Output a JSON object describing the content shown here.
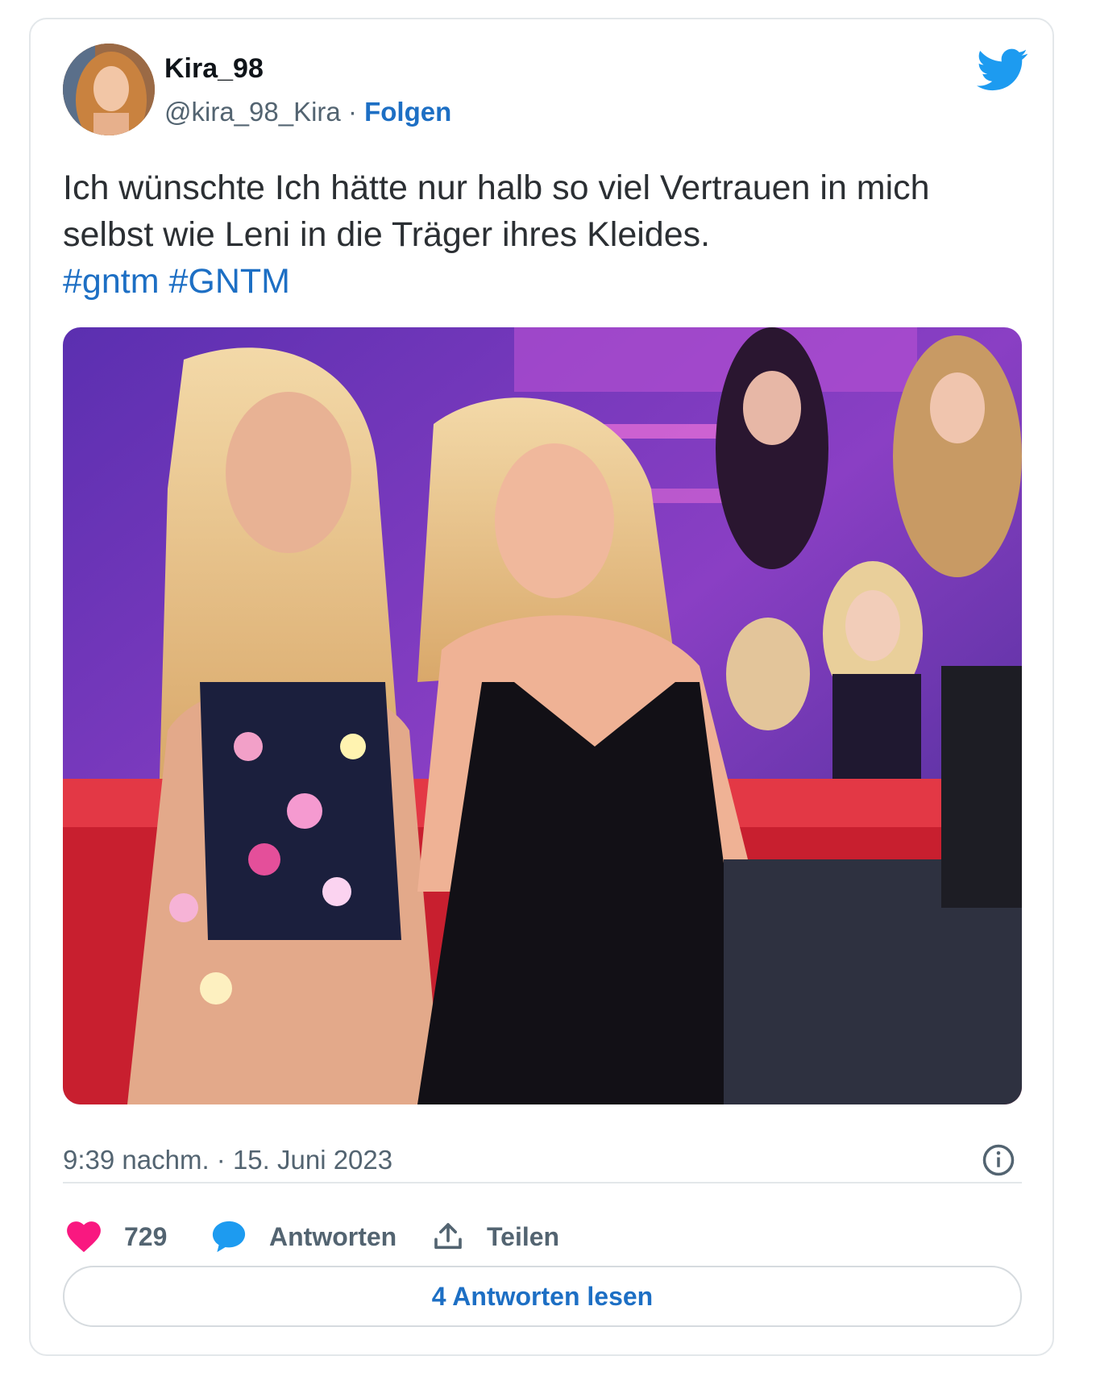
{
  "tweet": {
    "author_name": "Kira_98",
    "handle": "@kira_98_Kira",
    "separator": " · ",
    "follow_label": "Folgen",
    "text": "Ich wünschte Ich hätte nur halb so viel Vertrauen in mich selbst wie Leni in die Träger ihres Kleides.",
    "hashtags": [
      "#gntm",
      "#GNTM"
    ],
    "timestamp": "9:39 nachm. · 15. Juni 2023",
    "likes_count": "729",
    "reply_label": "Antworten",
    "share_label": "Teilen",
    "read_replies_label": "4 Antworten lesen"
  },
  "icons": {
    "brand": "twitter-bird-icon",
    "info": "info-icon",
    "like": "heart-icon",
    "reply": "speech-bubble-icon",
    "share": "share-upload-icon"
  },
  "colors": {
    "link": "#1d6fc4",
    "twitter_blue": "#1d9bf0",
    "heart": "#f91880",
    "muted_text": "#536471",
    "border": "#e3e7ea"
  }
}
